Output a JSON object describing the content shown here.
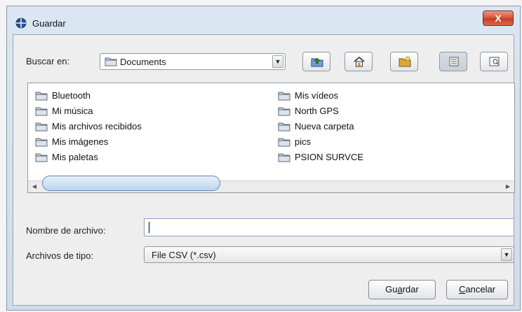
{
  "dialog": {
    "title": "Guardar",
    "close_label": "X"
  },
  "look_in": {
    "label": "Buscar en:",
    "value": "Documents"
  },
  "toolbar": [
    {
      "name": "up-one-level-button",
      "icon": "folder-up-icon"
    },
    {
      "name": "home-button",
      "icon": "home-icon"
    },
    {
      "name": "new-folder-button",
      "icon": "new-folder-icon"
    },
    {
      "name": "list-view-button",
      "icon": "list-view-icon"
    },
    {
      "name": "details-view-button",
      "icon": "details-view-icon"
    }
  ],
  "files": {
    "col1": [
      "Bluetooth",
      "Mi música",
      "Mis archivos recibidos",
      "Mis imágenes",
      "Mis paletas"
    ],
    "col2": [
      "Mis vídeos",
      "North GPS",
      "Nueva carpeta",
      "pics",
      "PSION SURVCE"
    ]
  },
  "filename": {
    "label": "Nombre de archivo:",
    "value": ""
  },
  "filetype": {
    "label": "Archivos de tipo:",
    "value": "File CSV (*.csv)"
  },
  "buttons": {
    "save_pre": "Gu",
    "save_mn": "a",
    "save_post": "rdar",
    "cancel_mn": "C",
    "cancel_post": "ancelar"
  }
}
